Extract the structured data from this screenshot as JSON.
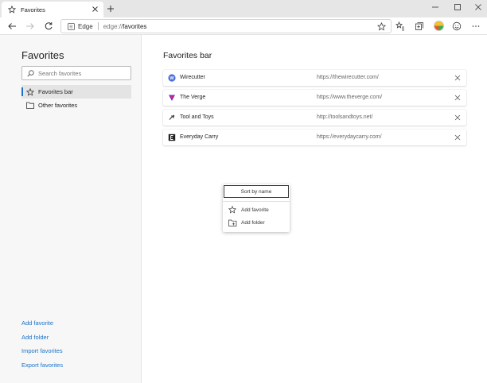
{
  "browser": {
    "tab": {
      "title": "Favorites"
    },
    "window_controls": {
      "minimize": "–",
      "maximize": "□",
      "close": "✕"
    },
    "address": {
      "site_label": "Edge",
      "url_prefix": "edge://",
      "url_path": "favorites"
    }
  },
  "sidebar": {
    "title": "Favorites",
    "search_placeholder": "Search favorites",
    "folders": [
      {
        "label": "Favorites bar",
        "icon": "star-icon",
        "active": true
      },
      {
        "label": "Other favorites",
        "icon": "folder-icon",
        "active": false
      }
    ],
    "actions": [
      "Add favorite",
      "Add folder",
      "Import favorites",
      "Export favorites"
    ]
  },
  "main": {
    "title": "Favorites bar",
    "items": [
      {
        "name": "Wirecutter",
        "url": "https://thewirecutter.com/",
        "icon": "W",
        "icon_color": "#4a6fdc"
      },
      {
        "name": "The Verge",
        "url": "https://www.theverge.com/",
        "icon": "V",
        "icon_color": "#7a2fd6"
      },
      {
        "name": "Tool and Toys",
        "url": "http://toolsandtoys.net/",
        "icon": "T",
        "icon_color": "#444444"
      },
      {
        "name": "Everyday Carry",
        "url": "https://everydaycarry.com/",
        "icon": "E",
        "icon_color": "#222222"
      }
    ]
  },
  "context_menu": {
    "sort": "Sort by name",
    "items": [
      {
        "label": "Add favorite",
        "icon": "star-add-icon"
      },
      {
        "label": "Add folder",
        "icon": "folder-add-icon"
      }
    ]
  },
  "colors": {
    "accent": "#1a73c9",
    "sidebar_bg": "#f7f7f7",
    "titlebar_bg": "#e6e6e6"
  }
}
